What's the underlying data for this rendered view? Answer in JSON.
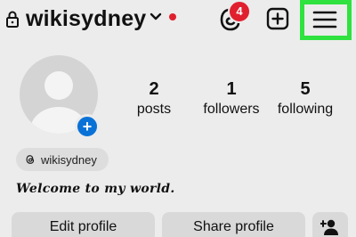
{
  "header": {
    "username": "wikisydney",
    "threads_badge_count": "4",
    "icons": {
      "lock": "lock-icon",
      "chevron": "chevron-down-icon",
      "threads": "threads-icon",
      "create": "plus-square-icon",
      "menu": "hamburger-menu-icon"
    },
    "menu_highlighted": true,
    "highlight_color": "#2fe23f",
    "dot_color": "#e0202e"
  },
  "profile": {
    "stats": [
      {
        "value": "2",
        "label": "posts"
      },
      {
        "value": "1",
        "label": "followers"
      },
      {
        "value": "5",
        "label": "following"
      }
    ],
    "threads_handle": "wikisydney",
    "bio": "Welcome to my world.",
    "add_badge_color": "#0a72d6"
  },
  "actions": {
    "edit_label": "Edit profile",
    "share_label": "Share profile"
  }
}
